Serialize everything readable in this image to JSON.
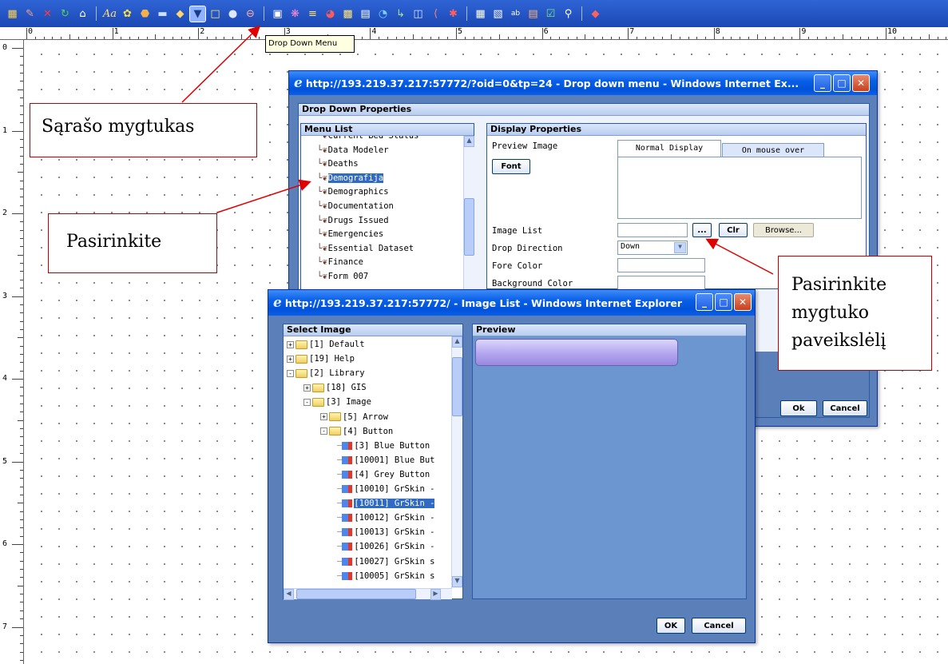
{
  "toolbar": {
    "icons": [
      "save-icon",
      "brush-icon",
      "delete-icon",
      "refresh-icon",
      "home-icon",
      "text-icon",
      "image-icon",
      "box-icon",
      "line-icon",
      "diamond-icon",
      "dropdown-menu-icon",
      "frame-icon",
      "globe-icon",
      "link-icon",
      "chart-icon",
      "network-icon",
      "list-icon",
      "pie-icon",
      "document-icon",
      "database-icon",
      "world-icon",
      "tree-icon",
      "screen-icon",
      "code-icon",
      "pdf-icon",
      "grid-icon",
      "table-icon",
      "textbox-icon",
      "form-icon",
      "checkbox-icon",
      "search-icon",
      "eraser-icon"
    ],
    "text_label": "Aa",
    "tooltip": "Drop Down Menu"
  },
  "ruler": {
    "h_numbers": [
      "0",
      "1",
      "2",
      "3",
      "4",
      "5",
      "6",
      "7",
      "8",
      "9",
      "10"
    ],
    "v_numbers": [
      "0",
      "1",
      "2",
      "3",
      "4",
      "5",
      "6",
      "7"
    ]
  },
  "dropdown_window": {
    "title": "http://193.219.37.217:57772/?oid=0&tp=24 - Drop down menu - Windows Internet Ex...",
    "section_title": "Drop Down Properties",
    "menu_list": {
      "header": "Menu List",
      "items": [
        "Current Bed Status",
        "Data Modeler",
        "Deaths",
        "Demografija",
        "Demographics",
        "Documentation",
        "Drugs Issued",
        "Emergencies",
        "Essential Dataset",
        "Finance",
        "Form 007"
      ],
      "selected": "Demografija"
    },
    "display": {
      "header": "Display Properties",
      "preview_image_label": "Preview Image",
      "tab_normal": "Normal Display",
      "tab_mouse_over": "On mouse over",
      "font_button": "Font",
      "image_list_label": "Image List",
      "ellipsis_button": "...",
      "clear_button": "Clr",
      "browse_button": "Browse...",
      "drop_direction_label": "Drop Direction",
      "drop_direction_value": "Down",
      "fore_color_label": "Fore Color",
      "background_color_label": "Background Color"
    },
    "ok_button": "Ok",
    "cancel_button": "Cancel"
  },
  "image_window": {
    "title": "http://193.219.37.217:57772/ - Image List - Windows Internet Explorer",
    "select_header": "Select Image",
    "preview_header": "Preview",
    "tree": [
      {
        "label": "[1] Default",
        "type": "folder",
        "level": 0,
        "expander": "+"
      },
      {
        "label": "[19] Help",
        "type": "folder",
        "level": 0,
        "expander": "+"
      },
      {
        "label": "[2] Library",
        "type": "folder",
        "level": 0,
        "expander": "-"
      },
      {
        "label": "[18] GIS",
        "type": "folder",
        "level": 1,
        "expander": "+"
      },
      {
        "label": "[3] Image",
        "type": "folder",
        "level": 1,
        "expander": "-"
      },
      {
        "label": "[5] Arrow",
        "type": "folder",
        "level": 2,
        "expander": "+"
      },
      {
        "label": "[4] Button",
        "type": "folder",
        "level": 2,
        "expander": "-"
      },
      {
        "label": "[3] Blue Button",
        "type": "image",
        "level": 3
      },
      {
        "label": "[10001] Blue But",
        "type": "image",
        "level": 3
      },
      {
        "label": "[4] Grey Button",
        "type": "image",
        "level": 3
      },
      {
        "label": "[10010] GrSkin -",
        "type": "image",
        "level": 3
      },
      {
        "label": "[10011] GrSkin -",
        "type": "image",
        "level": 3,
        "selected": true
      },
      {
        "label": "[10012] GrSkin -",
        "type": "image",
        "level": 3
      },
      {
        "label": "[10013] GrSkin -",
        "type": "image",
        "level": 3
      },
      {
        "label": "[10026] GrSkin -",
        "type": "image",
        "level": 3
      },
      {
        "label": "[10027] GrSkin s",
        "type": "image",
        "level": 3
      },
      {
        "label": "[10005] GrSkin s",
        "type": "image",
        "level": 3
      }
    ],
    "ok_button": "OK",
    "cancel_button": "Cancel"
  },
  "annotations": {
    "callout_list_button": "Sąrašo mygtukas",
    "callout_select": "Pasirinkite",
    "callout_select_image": [
      "Pasirinkite",
      "mygtuko",
      "paveikslėlį"
    ]
  },
  "colors": {
    "toolbar": "#1b48b4",
    "xp_title": "#0a5fe8",
    "window_body": "#5b7fb9",
    "preview_area": "#6b96cf",
    "selection": "#316ac5",
    "annotation_border": "#c00000"
  }
}
